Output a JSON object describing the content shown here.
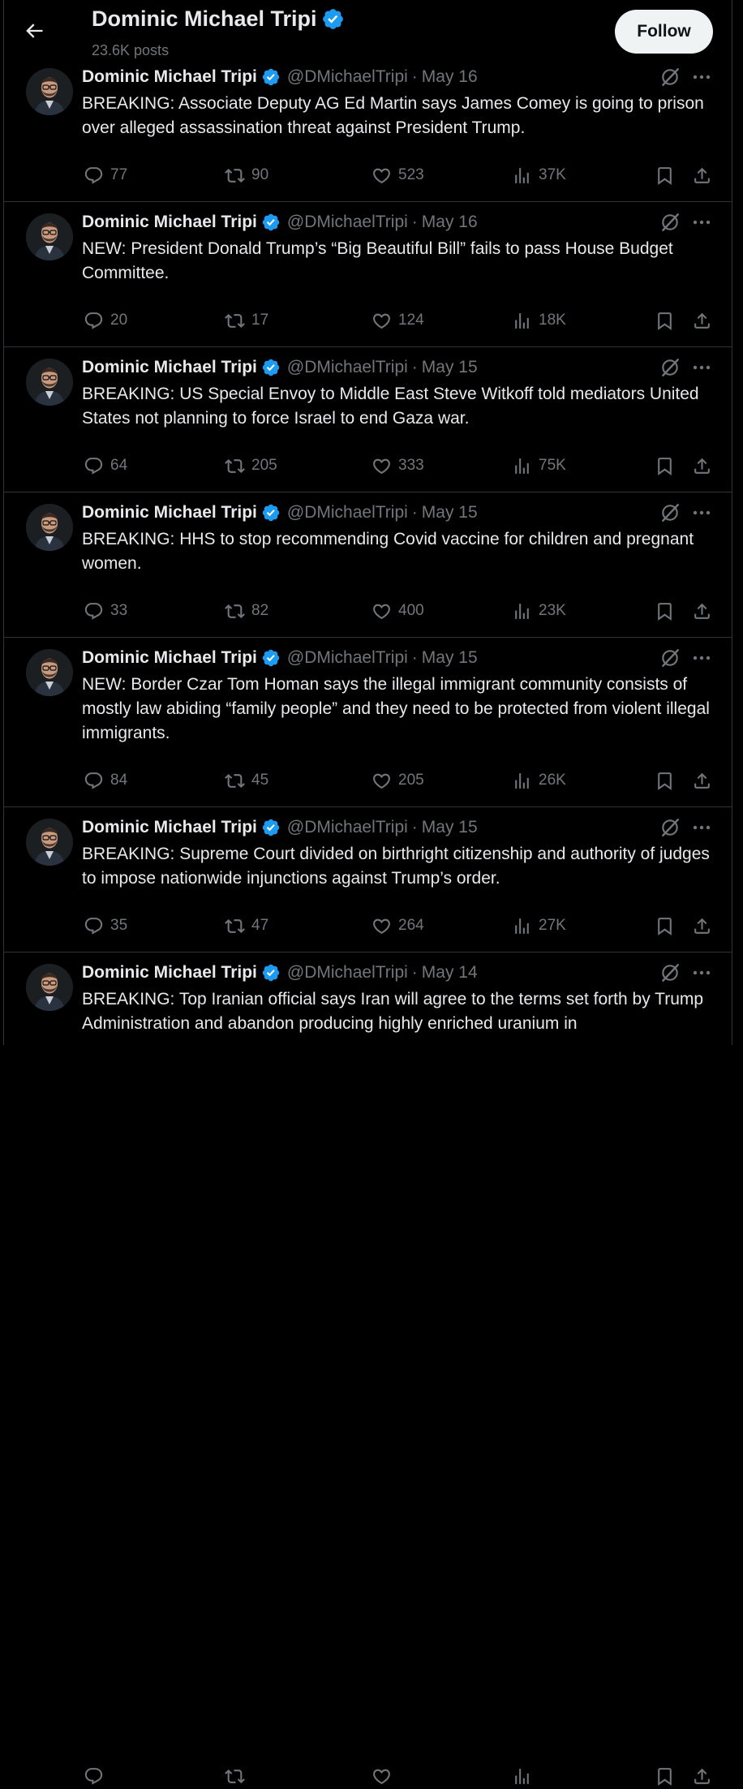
{
  "header": {
    "name": "Dominic Michael Tripi",
    "posts": "23.6K posts",
    "follow_label": "Follow"
  },
  "colors": {
    "accent": "#1d9bf0",
    "background": "#000000",
    "muted": "#71767b",
    "text": "#e7e9ea"
  },
  "icons": [
    "back-arrow-icon",
    "verified-badge-icon",
    "grok-icon",
    "more-icon",
    "reply-icon",
    "retweet-icon",
    "like-icon",
    "views-icon",
    "bookmark-icon",
    "share-icon"
  ],
  "tweets": [
    {
      "name": "Dominic Michael Tripi",
      "handle": "@DMichaelTripi",
      "dot": "·",
      "date": "May 16",
      "text": "BREAKING: Associate Deputy AG Ed Martin says James Comey is going to prison over alleged assassination threat against President Trump.",
      "replies": "77",
      "reposts": "90",
      "likes": "523",
      "views": "37K"
    },
    {
      "name": "Dominic Michael Tripi",
      "handle": "@DMichaelTripi",
      "dot": "·",
      "date": "May 16",
      "text": "NEW: President Donald Trump’s “Big Beautiful Bill” fails to pass House Budget Committee.",
      "replies": "20",
      "reposts": "17",
      "likes": "124",
      "views": "18K"
    },
    {
      "name": "Dominic Michael Tripi",
      "handle": "@DMichaelTripi",
      "dot": "·",
      "date": "May 15",
      "text": "BREAKING: US Special Envoy to Middle East Steve Witkoff told mediators United States not planning to force Israel to end Gaza war.",
      "replies": "64",
      "reposts": "205",
      "likes": "333",
      "views": "75K"
    },
    {
      "name": "Dominic Michael Tripi",
      "handle": "@DMichaelTripi",
      "dot": "·",
      "date": "May 15",
      "text": "BREAKING: HHS to stop recommending Covid vaccine for children and pregnant women.",
      "replies": "33",
      "reposts": "82",
      "likes": "400",
      "views": "23K"
    },
    {
      "name": "Dominic Michael Tripi",
      "handle": "@DMichaelTripi",
      "dot": "·",
      "date": "May 15",
      "text": "NEW: Border Czar Tom Homan says the illegal immigrant community consists of mostly law abiding “family people” and they need to be protected from violent illegal immigrants.",
      "replies": "84",
      "reposts": "45",
      "likes": "205",
      "views": "26K"
    },
    {
      "name": "Dominic Michael Tripi",
      "handle": "@DMichaelTripi",
      "dot": "·",
      "date": "May 15",
      "text": "BREAKING: Supreme Court divided on birthright citizenship and authority of judges to impose nationwide injunctions against Trump’s order.",
      "replies": "35",
      "reposts": "47",
      "likes": "264",
      "views": "27K"
    },
    {
      "name": "Dominic Michael Tripi",
      "handle": "@DMichaelTripi",
      "dot": "·",
      "date": "May 14",
      "text": "BREAKING: Top Iranian official says Iran will agree to the terms set forth by Trump Administration and abandon producing highly enriched uranium in",
      "replies": "",
      "reposts": "",
      "likes": "",
      "views": ""
    }
  ]
}
